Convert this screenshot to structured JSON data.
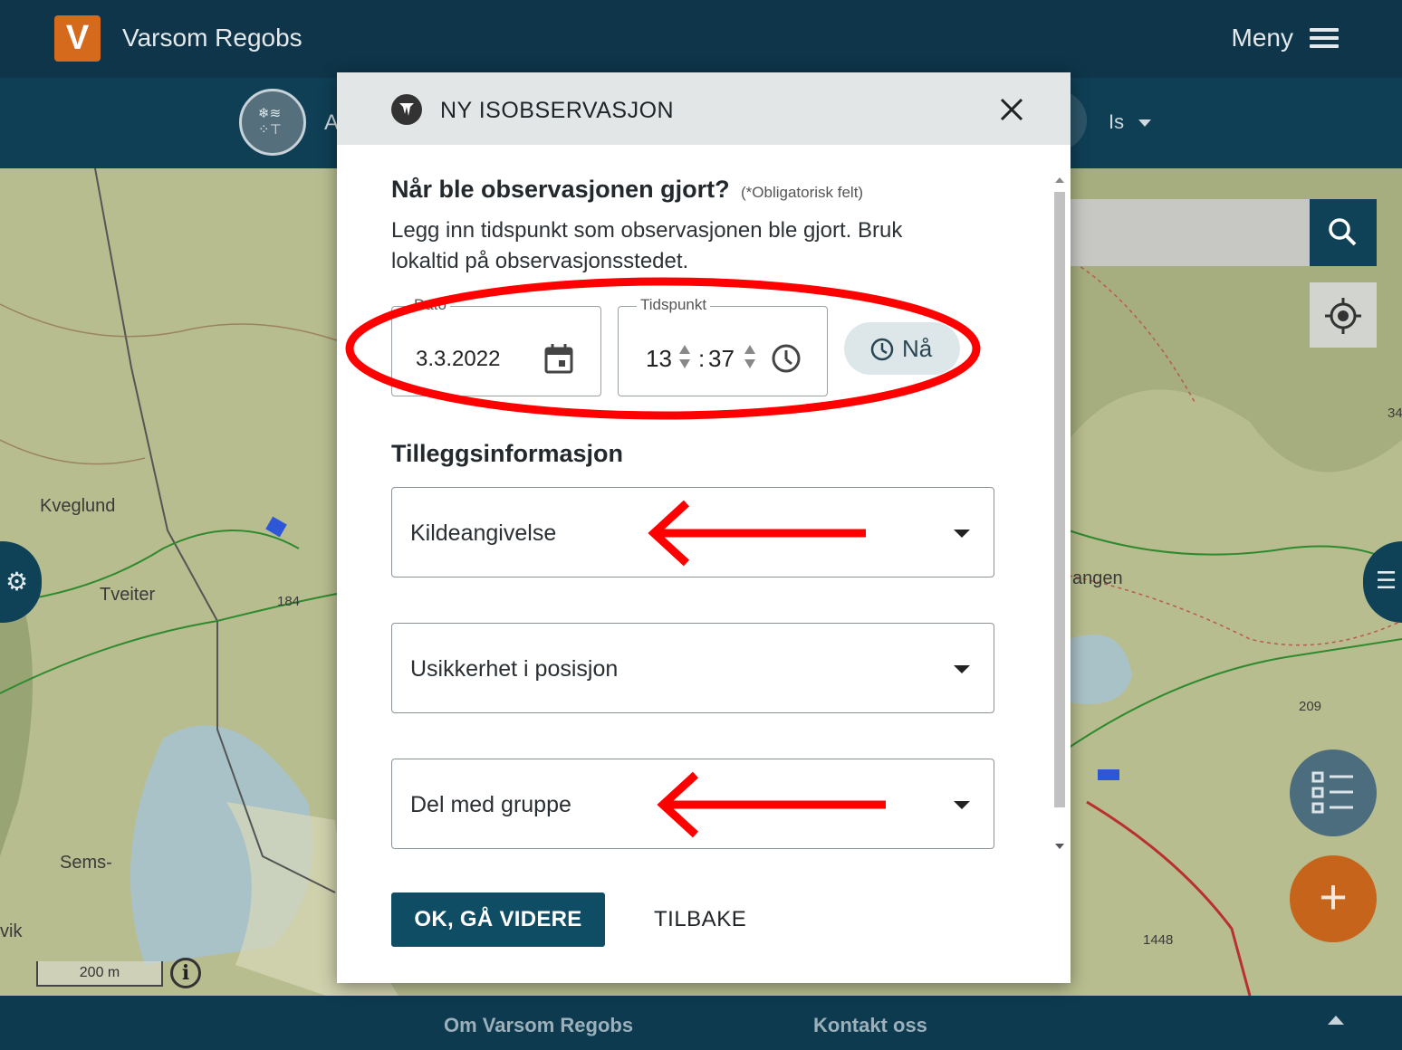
{
  "header": {
    "logo_letter": "V",
    "app_title": "Varsom Regobs",
    "menu_label": "Meny"
  },
  "subheader": {
    "partial_label": "A",
    "type_dropdown": "Is"
  },
  "map": {
    "labels": [
      "Kveglund",
      "Tveiter",
      "Sems-",
      "vik",
      "angen",
      "184",
      "209",
      "1448",
      "34"
    ],
    "scale_label": "200 m",
    "info_symbol": "i"
  },
  "modal": {
    "title": "NY ISOBSERVASJON",
    "question_title": "Når ble observasjonen gjort?",
    "required_note": "(*Obligatorisk felt)",
    "description": "Legg inn tidspunkt som observasjonen ble gjort. Bruk lokaltid på observasjonsstedet.",
    "date_field": {
      "legend": "Dato",
      "value": "3.3.2022"
    },
    "time_field": {
      "legend": "Tidspunkt",
      "hours": "13",
      "separator": ":",
      "minutes": "37"
    },
    "now_button": "Nå",
    "extra_section_title": "Tilleggsinformasjon",
    "selects": [
      "Kildeangivelse",
      "Usikkerhet i posisjon",
      "Del med gruppe"
    ],
    "ok_button": "OK, GÅ VIDERE",
    "back_button": "TILBAKE"
  },
  "footer": {
    "about_link": "Om Varsom Regobs",
    "contact_link": "Kontakt oss"
  },
  "colors": {
    "primary": "#0e4d64",
    "header_bg": "#0e3549",
    "accent_orange": "#d56a1c",
    "annotation_red": "#ff0000"
  }
}
